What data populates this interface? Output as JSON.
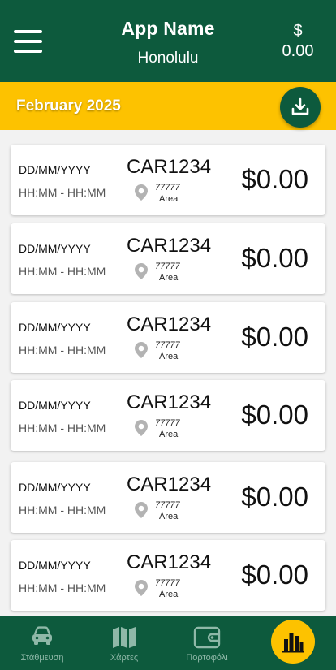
{
  "header": {
    "app_name": "App Name",
    "city": "Honolulu",
    "balance_currency": "$",
    "balance_value": "0.00",
    "menu_icon": "hamburger-menu-icon"
  },
  "month_bar": {
    "label": "February 2025",
    "download_icon": "download-icon"
  },
  "items": [
    {
      "date": "DD/MM/YYYY",
      "time": "HH:MM - HH:MM",
      "plate": "CAR1234",
      "zip": "77777",
      "area": "Area",
      "price": "$0.00"
    },
    {
      "date": "DD/MM/YYYY",
      "time": "HH:MM - HH:MM",
      "plate": "CAR1234",
      "zip": "77777",
      "area": "Area",
      "price": "$0.00"
    },
    {
      "date": "DD/MM/YYYY",
      "time": "HH:MM - HH:MM",
      "plate": "CAR1234",
      "zip": "77777",
      "area": "Area",
      "price": "$0.00"
    },
    {
      "date": "DD/MM/YYYY",
      "time": "HH:MM - HH:MM",
      "plate": "CAR1234",
      "zip": "77777",
      "area": "Area",
      "price": "$0.00"
    },
    {
      "date": "DD/MM/YYYY",
      "time": "HH:MM - HH:MM",
      "plate": "CAR1234",
      "zip": "77777",
      "area": "Area",
      "price": "$0.00"
    },
    {
      "date": "DD/MM/YYYY",
      "time": "HH:MM - HH:MM",
      "plate": "CAR1234",
      "zip": "77777",
      "area": "Area",
      "price": "$0.00"
    }
  ],
  "nav": [
    {
      "label": "Στάθμευση",
      "icon": "car-icon"
    },
    {
      "label": "Χάρτες",
      "icon": "map-icon"
    },
    {
      "label": "Πορτοφόλι",
      "icon": "wallet-icon"
    },
    {
      "label": "",
      "icon": "bar-chart-icon",
      "active": true
    }
  ],
  "colors": {
    "primary": "#0d5a3d",
    "accent": "#fdc200",
    "background": "#f2f2f2",
    "nav_label": "#8fb8a8"
  }
}
